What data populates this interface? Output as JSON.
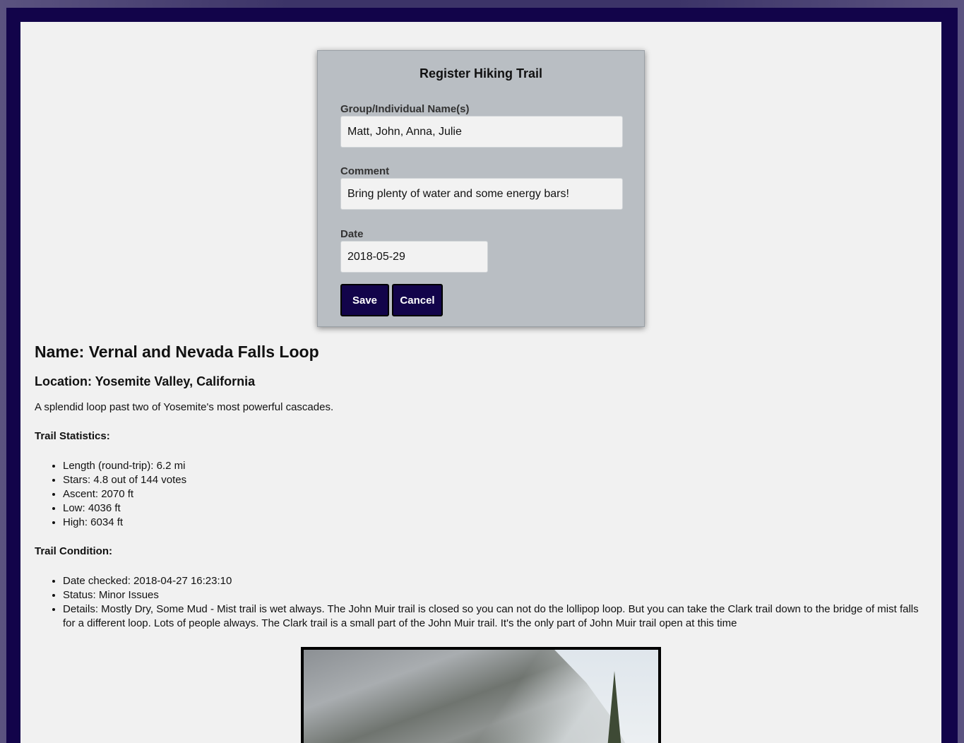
{
  "form": {
    "title": "Register Hiking Trail",
    "name_label": "Group/Individual Name(s)",
    "name_value": "Matt, John, Anna, Julie",
    "comment_label": "Comment",
    "comment_value": "Bring plenty of water and some energy bars!",
    "date_label": "Date",
    "date_value": "2018-05-29",
    "save_label": "Save",
    "cancel_label": "Cancel"
  },
  "trail": {
    "name": "Name: Vernal and Nevada Falls Loop",
    "location": "Location: Yosemite Valley, California",
    "description": "A splendid loop past two of Yosemite's most powerful cascades.",
    "statistics_heading": "Trail Statistics:",
    "statistics": [
      "Length (round-trip): 6.2 mi",
      "Stars: 4.8 out of 144 votes",
      "Ascent: 2070 ft",
      "Low: 4036 ft",
      "High: 6034 ft"
    ],
    "condition_heading": "Trail Condition:",
    "condition": [
      "Date checked: 2018-04-27 16:23:10",
      "Status: Minor Issues",
      "Details: Mostly Dry, Some Mud - Mist trail is wet always. The John Muir trail is closed so you can not do the lollipop loop. But you can take the Clark trail down to the bridge of mist falls for a different loop. Lots of people always. The Clark trail is a small part of the John Muir trail. It's the only part of John Muir trail open at this time"
    ]
  },
  "colors": {
    "primary": "#12044a",
    "panel": "#b9bec3",
    "page": "#f1f1f1"
  }
}
